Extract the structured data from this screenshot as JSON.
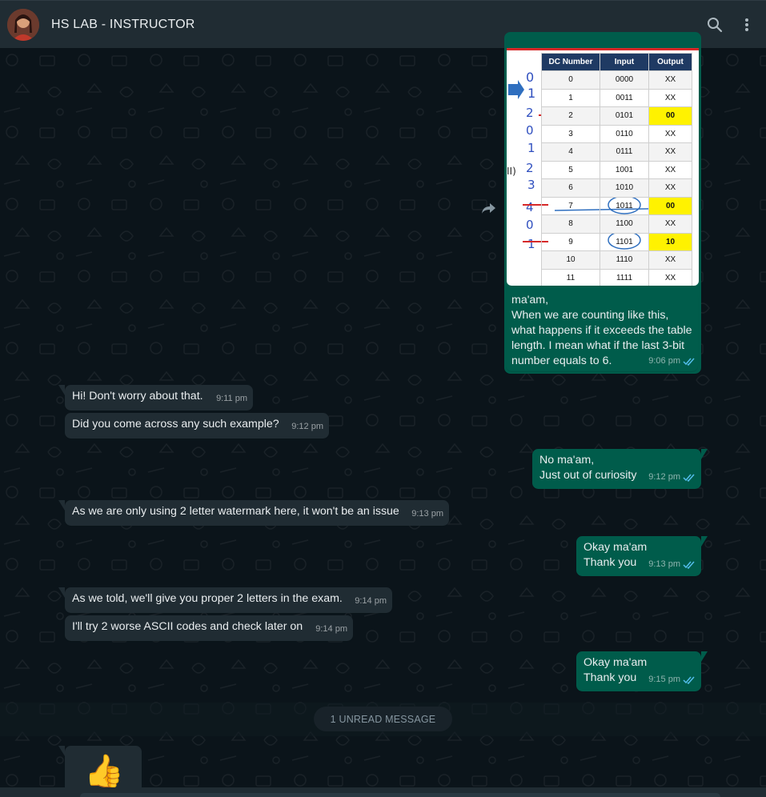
{
  "header": {
    "title": "HS LAB - INSTRUCTOR",
    "avatar_icon": "contact-avatar",
    "search_icon": "search-icon",
    "menu_icon": "more-vert-icon"
  },
  "image_message": {
    "table": {
      "headers": [
        "DC Number",
        "Input",
        "Output"
      ],
      "rows": [
        [
          "0",
          "0000",
          "XX"
        ],
        [
          "1",
          "0011",
          "XX"
        ],
        [
          "2",
          "0101",
          "00"
        ],
        [
          "3",
          "0110",
          "XX"
        ],
        [
          "4",
          "0111",
          "XX"
        ],
        [
          "5",
          "1001",
          "XX"
        ],
        [
          "6",
          "1010",
          "XX"
        ],
        [
          "7",
          "1011",
          "00"
        ],
        [
          "8",
          "1100",
          "XX"
        ],
        [
          "9",
          "1101",
          "10"
        ],
        [
          "10",
          "1110",
          "XX"
        ],
        [
          "11",
          "1111",
          "XX"
        ]
      ],
      "highlighted_rows": [
        2,
        7,
        9
      ]
    },
    "caption": "ma'am,\nWhen we are counting like this, what happens if it exceeds the table length. I mean what if the last 3-bit number equals to 6.",
    "time": "9:06 pm"
  },
  "messages": [
    {
      "text": "Hi! Don't worry about that.",
      "time": "9:11 pm",
      "direction": "in"
    },
    {
      "text": "Did you come across any such example?",
      "time": "9:12 pm",
      "direction": "in"
    },
    {
      "text": "No ma'am,\nJust out of curiosity",
      "time": "9:12 pm",
      "direction": "out"
    },
    {
      "text": "As we are only using 2 letter watermark here, it won't be an issue",
      "time": "9:13 pm",
      "direction": "in"
    },
    {
      "text": "Okay ma'am\nThank you",
      "time": "9:13 pm",
      "direction": "out"
    },
    {
      "text": "As we told, we'll give you proper 2 letters in the exam.",
      "time": "9:14 pm",
      "direction": "in"
    },
    {
      "text": "I'll try 2 worse ASCII codes and check later on",
      "time": "9:14 pm",
      "direction": "in"
    },
    {
      "text": "Okay ma'am\nThank you",
      "time": "9:15 pm",
      "direction": "out"
    }
  ],
  "unread_banner": "1 UNREAD MESSAGE",
  "last_message": {
    "emoji": "👍"
  },
  "colors": {
    "header_bg": "#202c33",
    "chat_bg": "#0b141a",
    "incoming_bubble": "#202c33",
    "outgoing_bubble": "#005c4b",
    "read_tick": "#53bdeb"
  }
}
